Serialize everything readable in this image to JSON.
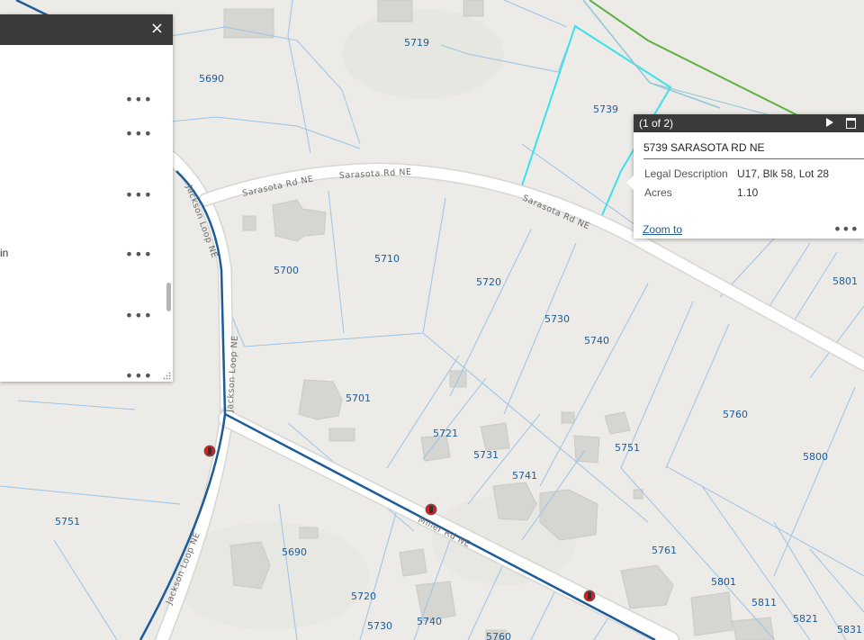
{
  "panel": {
    "close_icon": "×",
    "row_menu_icon": "•••",
    "row_menus": 6,
    "partial_text": "in"
  },
  "popup": {
    "counter": "(1 of 2)",
    "next_icon": "triangle-right-icon",
    "maximize_icon": "maximize-icon",
    "title": "5739 SARASOTA RD NE",
    "fields": [
      {
        "label": "Legal Description",
        "value": "U17, Blk 58, Lot 28"
      },
      {
        "label": "Acres",
        "value": "1.10"
      }
    ],
    "zoom_link": "Zoom to",
    "menu_icon": "•••"
  },
  "roads": {
    "sarasota_1": "Sarasota Rd NE",
    "sarasota_2": "Sarasota Rd NE",
    "sarasota_3": "Sarasota Rd NE",
    "jackson_1": "Jackson Loop NE",
    "jackson_2": "Jackson Loop NE",
    "jackson_3": "Jackson Loop NE",
    "miller": "Miller Rd NE"
  },
  "parcels": {
    "p5719": "5719",
    "p5690a": "5690",
    "p5739": "5739",
    "p5700": "5700",
    "p5710": "5710",
    "p5720a": "5720",
    "p5730a": "5730",
    "p5740a": "5740",
    "p5801a": "5801",
    "p5701": "5701",
    "p5721": "5721",
    "p5731": "5731",
    "p5751a": "5751",
    "p5741": "5741",
    "p5760a": "5760",
    "p5800": "5800",
    "p5751b": "5751",
    "p5690b": "5690",
    "p5761": "5761",
    "p5720b": "5720",
    "p5801b": "5801",
    "p5811": "5811",
    "p5730b": "5730",
    "p5740b": "5740",
    "p5760b": "5760",
    "p5821": "5821",
    "p5831": "5831"
  },
  "colors": {
    "background": "#ecebe7",
    "parcel_line": "#9cc3e6",
    "road": "#ffffff",
    "road_casing": "#d6d6d2",
    "waterline": "#1d5b99",
    "selection": "#3ee0ea",
    "green_line": "#5fb043",
    "building": "#d5d5d1",
    "hydrant": "#d32020"
  }
}
